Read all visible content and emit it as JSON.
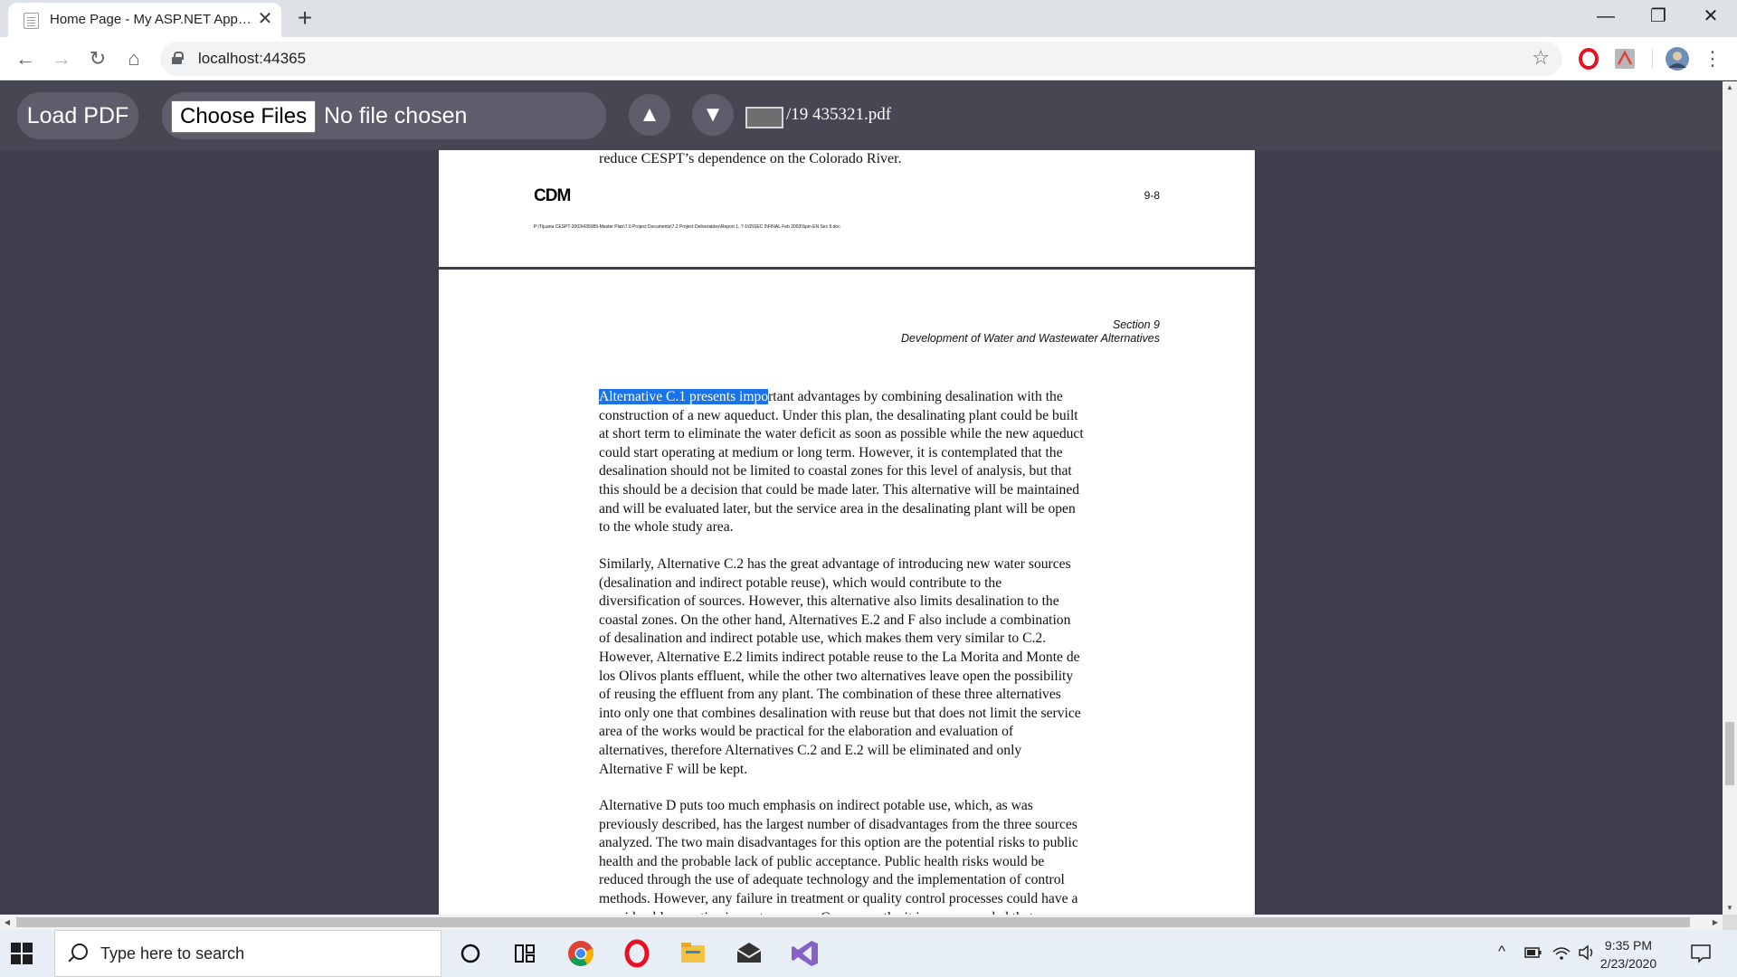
{
  "browser": {
    "tab_title": "Home Page - My ASP.NET Application",
    "new_tab": "+",
    "url": "localhost:44365",
    "nav": {
      "back": "←",
      "forward": "→",
      "reload": "↻",
      "home": "⌂",
      "bookmark": "☆",
      "menu": "⋮"
    },
    "window": {
      "minimize": "—",
      "restore": "❐",
      "close": "✕"
    }
  },
  "app": {
    "load_pdf_label": "Load PDF",
    "choose_files_label": "Choose Files",
    "no_file_label": "No file chosen",
    "prev_page": "▲",
    "next_page": "▼",
    "page_info": "/19 435321.pdf"
  },
  "doc": {
    "page1": {
      "tail_line": "reduce CESPT’s dependence on the Colorado River.",
      "logo": "CDM",
      "page_number": "9-8",
      "footer_path": "P:\\Tijuana CESPT-2003\\435089-Master Plan\\7.0 Project Documents\\7.2 Project Deliverables\\Report 1, 7-1\\05SEC 9\\FINAL Feb 2003\\Spin EN Sec 9.doc"
    },
    "page2": {
      "section_label": "Section 9",
      "section_title": "Development of Water and Wastewater Alternatives",
      "p1_highlight": "Alternative C.1 presents impo",
      "p1_rest": "rtant advantages by combining desalination with the\nconstruction of a new aqueduct.  Under this plan, the desalinating plant could be built\nat short term to eliminate the water deficit as soon as possible while the new aqueduct\ncould start operating at medium or long term.  However, it is contemplated that the\ndesalination should not be limited to coastal zones for this level of analysis, but that\nthis should be a decision that could be made later.  This alternative will be maintained\nand will be evaluated later, but the service area in the desalinating plant will be open\nto the whole study area.",
      "p2": "Similarly, Alternative C.2 has the great advantage of introducing new water sources\n(desalination and indirect potable reuse), which would contribute to the\ndiversification of sources.  However, this alternative also limits desalination to the\ncoastal zones.  On the other hand, Alternatives E.2 and F also include a combination\nof desalination and indirect potable use, which makes them very similar to C.2.\nHowever, Alternative E.2 limits indirect potable reuse to the La Morita and Monte de\nlos Olivos plants effluent, while the other two alternatives leave open the possibility\nof reusing the effluent from any plant.  The combination of these three alternatives\ninto only one that combines desalination with reuse but that does not limit the service\narea of the works would be practical for the elaboration and evaluation of\nalternatives, therefore Alternatives C.2 and E.2 will be eliminated and only\nAlternative F will be kept.",
      "p3": "Alternative D puts too much emphasis on indirect potable use, which, as was\npreviously described, has the largest number of disadvantages from the three sources\nanalyzed.  The two main disadvantages for this option are the potential risks to public\nhealth and the probable lack of public acceptance.  Public health risks would be\nreduced through the use of adequate technology and the implementation of control\nmethods.  However, any failure in treatment or quality control processes could have a\nconsiderable negative impact on users.  Consequently, it is recommended that any"
    }
  },
  "taskbar": {
    "search_placeholder": "Type here to search",
    "time": "9:35 PM",
    "date": "2/23/2020"
  },
  "colors": {
    "highlight": "#1a73e8",
    "app_toolbar": "#474753",
    "viewer_bg": "#3e3e4e"
  }
}
